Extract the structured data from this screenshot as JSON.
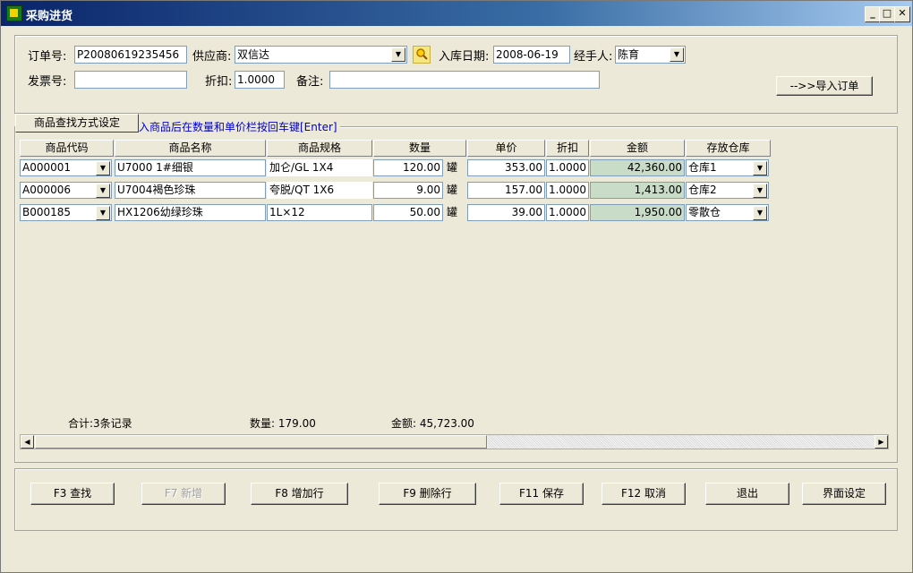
{
  "window": {
    "title": "采购进货",
    "minimize": "_",
    "maximize": "□",
    "close": "✕"
  },
  "header": {
    "order_label": "订单号:",
    "order_value": "P20080619235456",
    "supplier_label": "供应商:",
    "supplier_value": "双信达",
    "date_label": "入库日期:",
    "date_value": "2008-06-19",
    "handler_label": "经手人:",
    "handler_value": "陈育",
    "invoice_label": "发票号:",
    "invoice_value": "",
    "discount_label": "折扣:",
    "discount_value": "1.0000",
    "note_label": "备注:",
    "note_value": "",
    "import_button": "-->>导入订单"
  },
  "tab": {
    "label": "商品查找方式设定",
    "hint": "入商品后在数量和单价栏按回车键[Enter]"
  },
  "grid": {
    "columns": [
      "商品代码",
      "商品名称",
      "商品规格",
      "数量",
      "单价",
      "折扣",
      "金额",
      "存放仓库"
    ],
    "rows": [
      {
        "code": "A000001",
        "name": "U7000 1#细银",
        "spec": "加仑/GL      1X4",
        "qty": "120.00",
        "unit": "罐",
        "price": "353.00",
        "discount": "1.0000",
        "amount": "42,360.00",
        "warehouse": "仓库1"
      },
      {
        "code": "A000006",
        "name": "U7004褐色珍珠",
        "spec": "夸脱/QT      1X6",
        "qty": "9.00",
        "unit": "罐",
        "price": "157.00",
        "discount": "1.0000",
        "amount": "1,413.00",
        "warehouse": "仓库2"
      },
      {
        "code": "B000185",
        "name": "HX1206幼绿珍珠",
        "spec": "1L×12",
        "qty": "50.00",
        "unit": "罐",
        "price": "39.00",
        "discount": "1.0000",
        "amount": "1,950.00",
        "warehouse": "零散仓"
      }
    ]
  },
  "totals": {
    "records": "合计:3条记录",
    "quantity": "数量: 179.00",
    "amount": "金额:  45,723.00"
  },
  "buttons": {
    "find": "F3 查找",
    "new": "F7 新增",
    "add_row": "F8 增加行",
    "delete_row": "F9 删除行",
    "save": "F11 保存",
    "cancel": "F12 取消",
    "exit": "退出",
    "settings": "界面设定"
  },
  "icons": {
    "app": "app-icon",
    "search": "magnifier-icon",
    "dropdown": "chevron-down-icon"
  }
}
